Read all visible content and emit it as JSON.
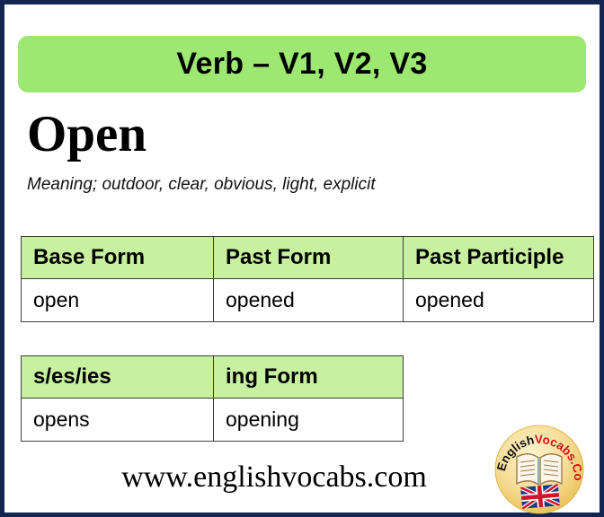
{
  "banner": {
    "title": "Verb – V1, V2, V3"
  },
  "word": {
    "headword": "Open",
    "meaning": "Meaning; outdoor, clear, obvious, light, explicit"
  },
  "tables": {
    "forms": {
      "headers": [
        "Base Form",
        "Past Form",
        "Past Participle"
      ],
      "row": [
        "open",
        "opened",
        "opened"
      ]
    },
    "inflections": {
      "headers": [
        "s/es/ies",
        "ing Form"
      ],
      "row": [
        "opens",
        "opening"
      ]
    }
  },
  "footer": {
    "site_url": "www.englishvocabs.com"
  },
  "logo": {
    "name_part1": "English",
    "name_part2": "Vocabs.Com",
    "icons": [
      "open-book-icon",
      "uk-flag-icon"
    ]
  },
  "colors": {
    "page_border": "#12264f",
    "banner_green": "#9de871",
    "table_header_green": "#c7f09f",
    "logo_gold": "#f2d479",
    "logo_red": "#d2131b",
    "flag_blue": "#1b3a87",
    "flag_red": "#cf142b"
  }
}
